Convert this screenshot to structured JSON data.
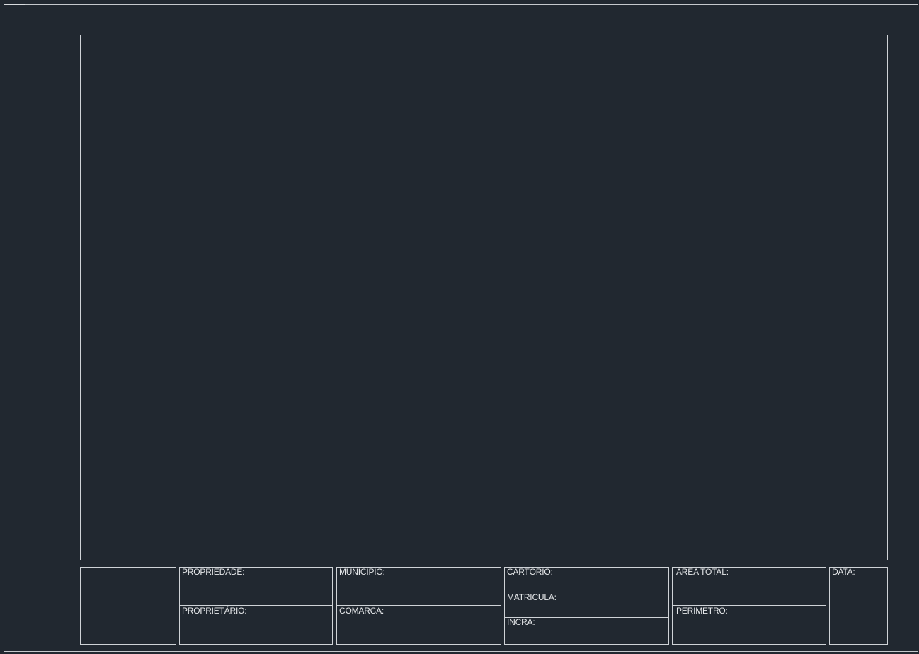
{
  "title_block": {
    "propriedade": "PROPRIEDADE:",
    "proprietario": "PROPRIETÁRIO:",
    "municipio": "MUNICIPIO:",
    "comarca": "COMARCA:",
    "cartorio": "CARTÓRIO:",
    "matricula": "MATRICULA:",
    "incra": "INCRA:",
    "area_total": "ÁREA TOTAL:",
    "perimetro": "PERIMETRO:",
    "data": "DATA:"
  }
}
